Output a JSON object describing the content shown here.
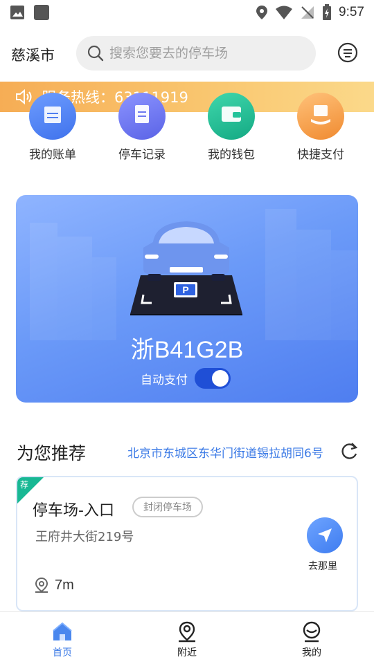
{
  "status_bar": {
    "time": "9:57"
  },
  "header": {
    "city": "慈溪市",
    "search_placeholder": "搜索您要去的停车场"
  },
  "hotline": {
    "text": "服务热线：63111919"
  },
  "quick_menu": [
    {
      "label": "我的账单",
      "icon": "bill-icon",
      "color": "#4f7ef0"
    },
    {
      "label": "停车记录",
      "icon": "record-icon",
      "color": "#6c78f0"
    },
    {
      "label": "我的钱包",
      "icon": "wallet-icon",
      "color": "#22c39a"
    },
    {
      "label": "快捷支付",
      "icon": "quick-pay-icon",
      "color": "#f6a04a"
    }
  ],
  "car_card": {
    "plate": "浙B41G2B",
    "autopay_label": "自动支付",
    "autopay_on": true,
    "parking_sign": "P"
  },
  "recommend": {
    "title": "为您推荐",
    "location": "北京市东城区东华门街道锡拉胡同6号",
    "lot": {
      "tag": "荐",
      "name": "停车场-入口",
      "badge": "封闭停车场",
      "street": "王府井大街219号",
      "go_label": "去那里",
      "distance": "7m"
    }
  },
  "bottom_nav": [
    {
      "label": "首页",
      "icon": "home-icon",
      "active": true
    },
    {
      "label": "附近",
      "icon": "nearby-location-icon",
      "active": false
    },
    {
      "label": "我的",
      "icon": "profile-icon",
      "active": false
    }
  ],
  "colors": {
    "accent": "#3b7ae6",
    "hotline_bg": "#f6ad55",
    "card_bg": "#6b9af8",
    "tag": "#18b894"
  }
}
